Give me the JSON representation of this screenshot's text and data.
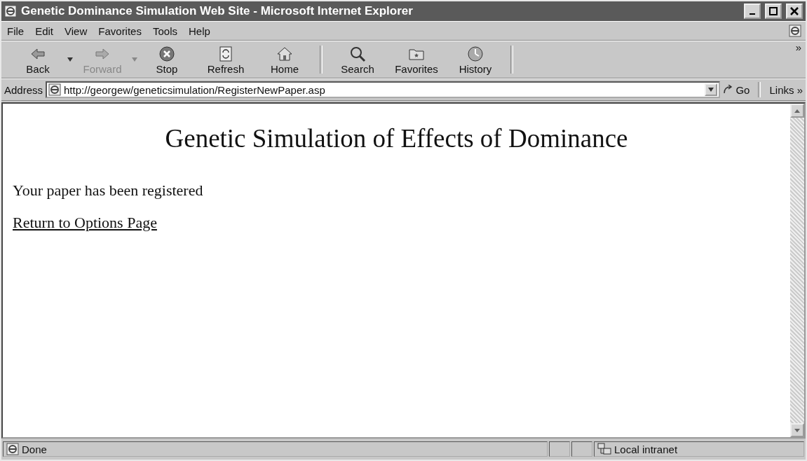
{
  "window": {
    "title": "Genetic Dominance Simulation Web Site - Microsoft Internet Explorer"
  },
  "menu": [
    {
      "label": "File"
    },
    {
      "label": "Edit"
    },
    {
      "label": "View"
    },
    {
      "label": "Favorites"
    },
    {
      "label": "Tools"
    },
    {
      "label": "Help"
    }
  ],
  "toolbar": [
    {
      "kind": "back",
      "label": "Back",
      "disabled": false,
      "dropdown": true
    },
    {
      "kind": "forward",
      "label": "Forward",
      "disabled": true,
      "dropdown": true
    },
    {
      "kind": "stop",
      "label": "Stop",
      "disabled": false,
      "dropdown": false
    },
    {
      "kind": "refresh",
      "label": "Refresh",
      "disabled": false,
      "dropdown": false
    },
    {
      "kind": "home",
      "label": "Home",
      "disabled": false,
      "dropdown": false
    },
    {
      "kind": "search",
      "label": "Search",
      "disabled": false,
      "dropdown": false
    },
    {
      "kind": "favorites",
      "label": "Favorites",
      "disabled": false,
      "dropdown": false
    },
    {
      "kind": "history",
      "label": "History",
      "disabled": false,
      "dropdown": false
    }
  ],
  "toolbar_more": "»",
  "address_bar": {
    "label": "Address",
    "url": "http://georgew/geneticsimulation/RegisterNewPaper.asp",
    "go": "Go",
    "links": "Links",
    "links_more": "»"
  },
  "page": {
    "heading": "Genetic Simulation of Effects of Dominance",
    "message": "Your paper has been registered",
    "link": "Return to Options Page"
  },
  "status_bar": {
    "text": "Done",
    "zone": "Local intranet"
  }
}
